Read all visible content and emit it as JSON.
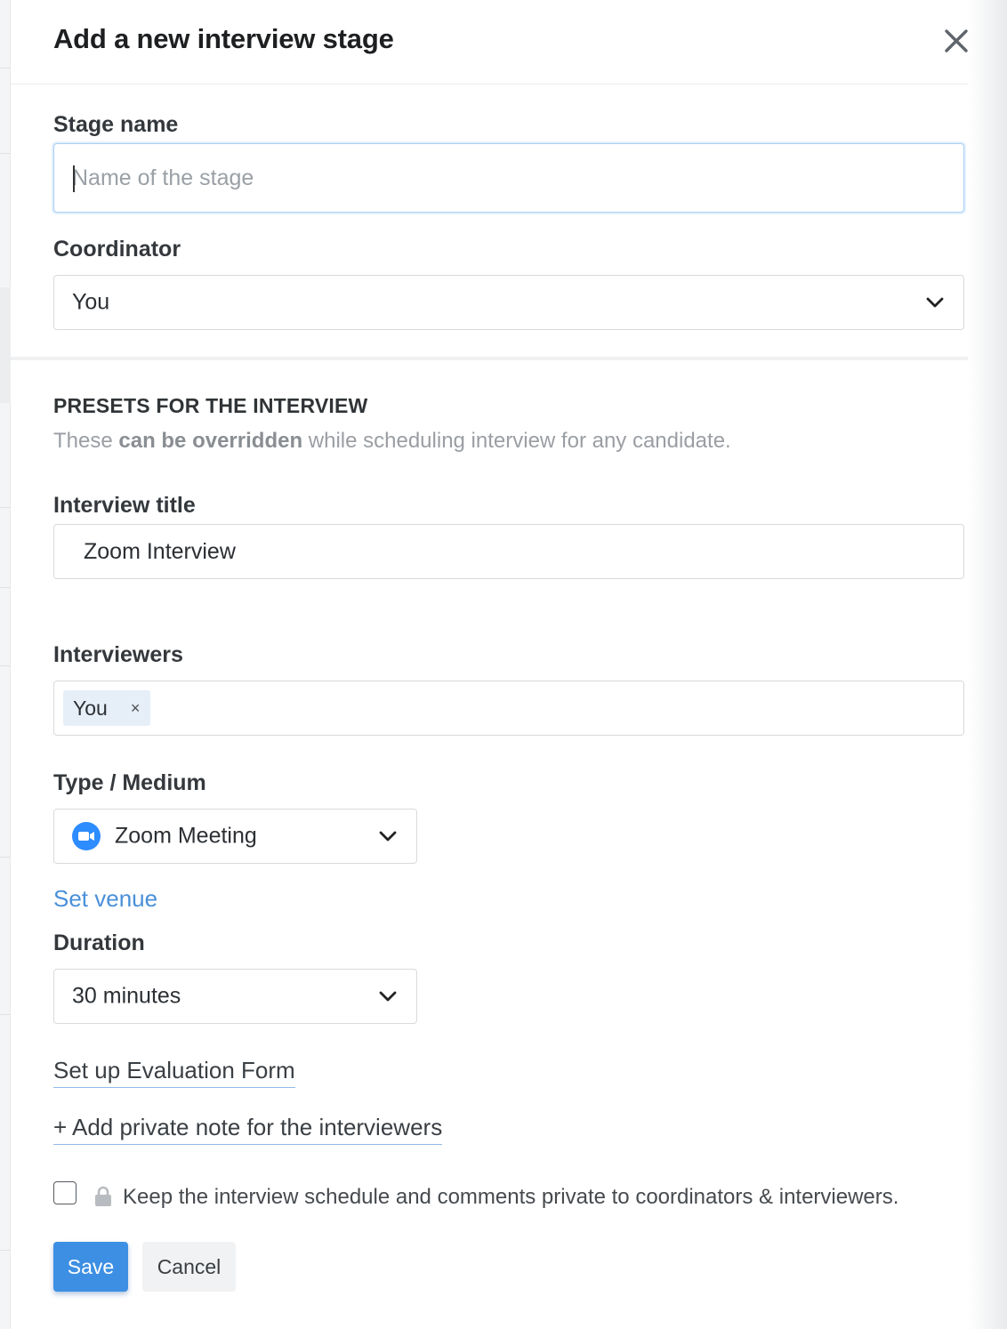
{
  "header": {
    "title": "Add a new interview stage"
  },
  "stage_name": {
    "label": "Stage name",
    "placeholder": "Name of the stage",
    "value": ""
  },
  "coordinator": {
    "label": "Coordinator",
    "selected": "You"
  },
  "presets": {
    "heading": "PRESETS FOR THE INTERVIEW",
    "sub_prefix": "These ",
    "sub_bold": "can be overridden",
    "sub_suffix": " while scheduling interview for any candidate."
  },
  "interview_title": {
    "label": "Interview title",
    "value": "Zoom Interview"
  },
  "interviewers": {
    "label": "Interviewers",
    "tags": [
      {
        "label": "You",
        "remove": "×"
      }
    ]
  },
  "type_medium": {
    "label": "Type / Medium",
    "selected": "Zoom Meeting",
    "icon": "zoom-video-icon"
  },
  "set_venue": {
    "label": "Set venue"
  },
  "duration": {
    "label": "Duration",
    "selected": "30 minutes"
  },
  "evaluation_form": {
    "label": "Set up Evaluation Form"
  },
  "private_note": {
    "label": "+ Add private note for the interviewers"
  },
  "privacy": {
    "label": "Keep the interview schedule and comments private to coordinators & interviewers.",
    "checked": false
  },
  "actions": {
    "save": "Save",
    "cancel": "Cancel"
  },
  "colors": {
    "accent": "#3d8fe3",
    "link": "#4a90d9",
    "tag_bg": "#e6eff8",
    "zoom_blue": "#2d8cff"
  }
}
